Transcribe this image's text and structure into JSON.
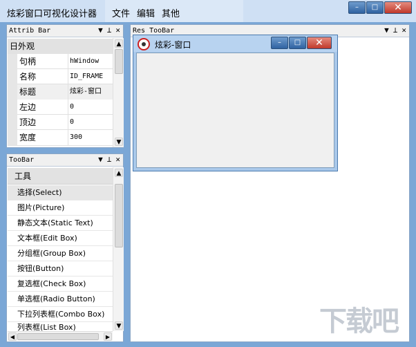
{
  "app": {
    "title": "炫彩窗口可视化设计器",
    "menu": [
      "文件",
      "编辑",
      "其他"
    ]
  },
  "attrib_bar": {
    "title": "Attrib Bar",
    "group": "日外观",
    "rows": [
      {
        "name": "句柄",
        "value": "hWindow"
      },
      {
        "name": "名称",
        "value": "ID_FRAME"
      },
      {
        "name": "标题",
        "value": "炫彩-窗口"
      },
      {
        "name": "左边",
        "value": "0"
      },
      {
        "name": "顶边",
        "value": "0"
      },
      {
        "name": "宽度",
        "value": "300"
      }
    ]
  },
  "toolbar_panel": {
    "title": "TooBar",
    "group": "工具",
    "items": [
      "选择(Select)",
      "图片(Picture)",
      "静态文本(Static Text)",
      "文本框(Edit Box)",
      "分组框(Group Box)",
      "按钮(Button)",
      "复选框(Check Box)",
      "单选框(Radio Button)",
      "下拉列表框(Combo Box)",
      "列表框(List Box)"
    ]
  },
  "res_panel": {
    "title": "Res TooBar"
  },
  "design_window": {
    "title": "炫彩-窗口"
  },
  "icons": {
    "dropdown": "▼",
    "pin": "⊥",
    "close": "✕",
    "minimize": "–",
    "maximize": "□",
    "scroll_up": "▲",
    "scroll_down": "▼",
    "scroll_left": "◀",
    "scroll_right": "▶"
  },
  "watermark": "下载吧"
}
